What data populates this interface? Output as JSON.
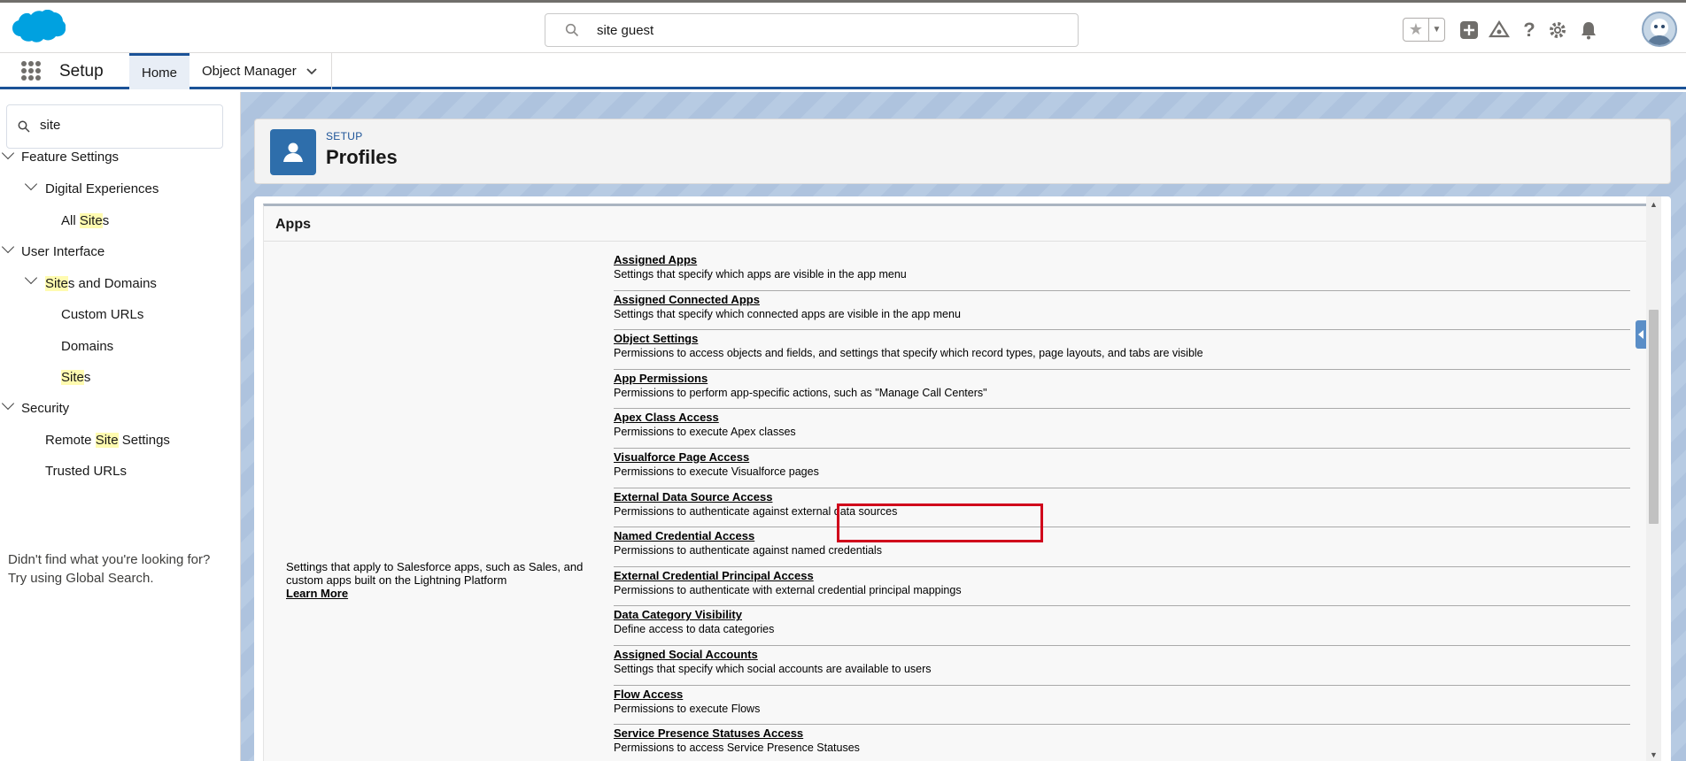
{
  "header": {
    "search_query": "site guest"
  },
  "nav": {
    "app_name": "Setup",
    "tabs": [
      {
        "label": "Home"
      },
      {
        "label": "Object Manager"
      }
    ]
  },
  "sidebar": {
    "quickfind_value": "site",
    "tree": [
      {
        "label": "Feature Settings"
      },
      {
        "label": "Digital Experiences"
      },
      {
        "label_pre": "All ",
        "label_hl": "Site",
        "label_post": "s"
      },
      {
        "label": "User Interface"
      },
      {
        "label_pre": "",
        "label_hl": "Site",
        "label_post": "s and Domains"
      },
      {
        "label": "Custom URLs"
      },
      {
        "label": "Domains"
      },
      {
        "label_pre": "",
        "label_hl": "Site",
        "label_post": "s"
      },
      {
        "label": "Security"
      },
      {
        "label_pre": "Remote ",
        "label_hl": "Site",
        "label_post": " Settings"
      },
      {
        "label": "Trusted URLs"
      }
    ],
    "not_found_line1": "Didn't find what you're looking for?",
    "not_found_line2": "Try using Global Search."
  },
  "page": {
    "setup_label": "SETUP",
    "title": "Profiles"
  },
  "apps": {
    "section_title": "Apps",
    "description": "Settings that apply to Salesforce apps, such as Sales, and custom apps built on the Lightning Platform",
    "learn_more": "Learn More",
    "items": [
      {
        "title": "Assigned Apps",
        "desc": "Settings that specify which apps are visible in the app menu"
      },
      {
        "title": "Assigned Connected Apps",
        "desc": "Settings that specify which connected apps are visible in the app menu"
      },
      {
        "title": "Object Settings",
        "desc": "Permissions to access objects and fields, and settings that specify which record types, page layouts, and tabs are visible"
      },
      {
        "title": "App Permissions",
        "desc": "Permissions to perform app-specific actions, such as \"Manage Call Centers\""
      },
      {
        "title": "Apex Class Access",
        "desc": "Permissions to execute Apex classes"
      },
      {
        "title": "Visualforce Page Access",
        "desc": "Permissions to execute Visualforce pages"
      },
      {
        "title": "External Data Source Access",
        "desc": "Permissions to authenticate against external data sources"
      },
      {
        "title": "Named Credential Access",
        "desc": "Permissions to authenticate against named credentials"
      },
      {
        "title": "External Credential Principal Access",
        "desc": "Permissions to authenticate with external credential principal mappings"
      },
      {
        "title": "Data Category Visibility",
        "desc": "Define access to data categories"
      },
      {
        "title": "Assigned Social Accounts",
        "desc": "Settings that specify which social accounts are available to users"
      },
      {
        "title": "Flow Access",
        "desc": "Permissions to execute Flows"
      },
      {
        "title": "Service Presence Statuses Access",
        "desc": "Permissions to access Service Presence Statuses"
      }
    ]
  },
  "colors": {
    "brand_blue": "#1b5297",
    "highlight_box": "#d0021b",
    "search_highlight": "#fffbb0"
  }
}
